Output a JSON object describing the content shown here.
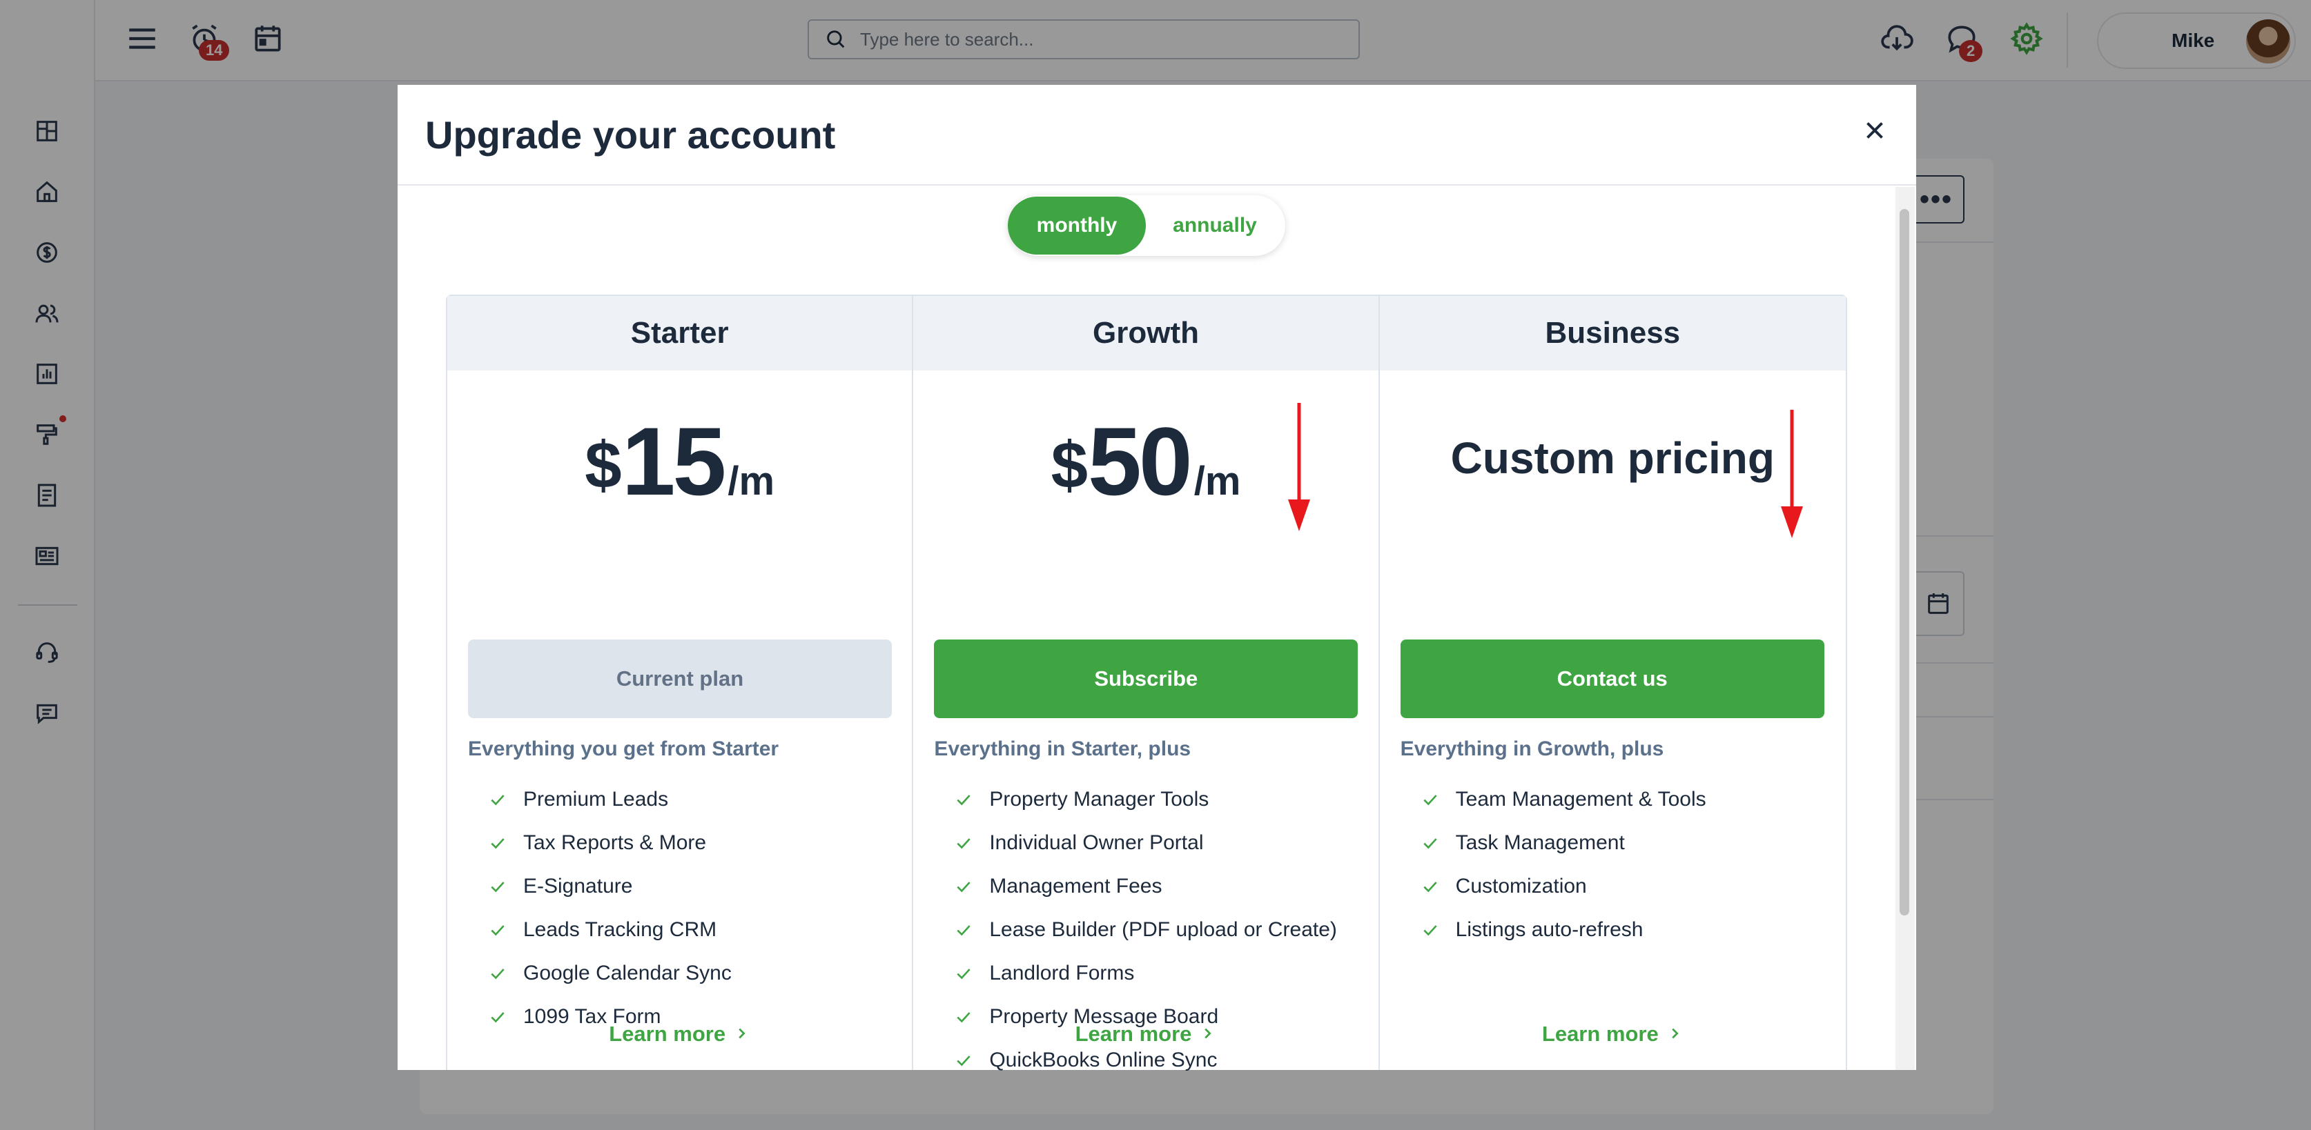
{
  "topbar": {
    "alarm_badge": "14",
    "messages_badge": "2",
    "search_placeholder": "Type here to search...",
    "user_name": "Mike"
  },
  "sidebar": {
    "items": [
      "dashboard-icon",
      "home-icon",
      "dollar-icon",
      "people-icon",
      "chart-icon",
      "paint-roller-icon",
      "document-icon",
      "listings-icon",
      "support-icon",
      "chat-icon"
    ]
  },
  "modal": {
    "title": "Upgrade your account",
    "billing": {
      "monthly": "monthly",
      "annually": "annually",
      "selected": "monthly"
    },
    "plans": [
      {
        "name": "Starter",
        "price_currency": "$",
        "price_amount": "15",
        "price_period": "/m",
        "cta": "Current plan",
        "subtitle": "Everything you get from Starter",
        "features": [
          "Premium Leads",
          "Tax Reports & More",
          "E-Signature",
          "Leads Tracking CRM",
          "Google Calendar Sync",
          "1099 Tax Form"
        ],
        "learn_more": "Learn more"
      },
      {
        "name": "Growth",
        "price_currency": "$",
        "price_amount": "50",
        "price_period": "/m",
        "cta": "Subscribe",
        "subtitle": "Everything in Starter, plus",
        "features": [
          "Property Manager Tools",
          "Individual Owner Portal",
          "Management Fees",
          "Lease Builder (PDF upload or Create)",
          "Landlord Forms",
          "Property Message Board",
          "QuickBooks Online Sync"
        ],
        "learn_more": "Learn more"
      },
      {
        "name": "Business",
        "price_text": "Custom pricing",
        "cta": "Contact us",
        "subtitle": "Everything in Growth, plus",
        "features": [
          "Team Management & Tools",
          "Task Management",
          "Customization",
          "Listings auto-refresh"
        ],
        "learn_more": "Learn more"
      }
    ]
  },
  "colors": {
    "accent": "#3ea542",
    "annotation_arrow": "#e8191c",
    "badge": "#c92f2f"
  }
}
